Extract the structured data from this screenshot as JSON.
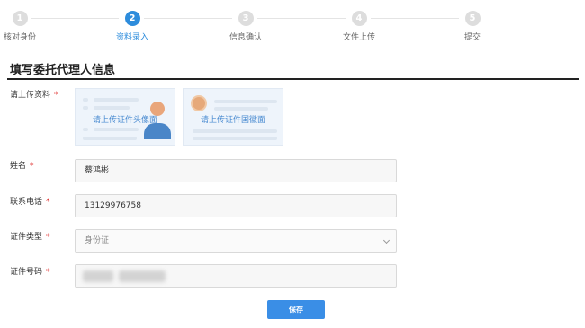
{
  "steps": [
    {
      "number": "1",
      "label": "核对身份",
      "active": false
    },
    {
      "number": "2",
      "label": "资料录入",
      "active": true
    },
    {
      "number": "3",
      "label": "信息确认",
      "active": false
    },
    {
      "number": "4",
      "label": "文件上传",
      "active": false
    },
    {
      "number": "5",
      "label": "提交",
      "active": false
    }
  ],
  "section_title": "填写委托代理人信息",
  "form": {
    "upload": {
      "label": "请上传资料",
      "front_card_text": "请上传证件头像面",
      "back_card_text": "请上传证件国徽面"
    },
    "name": {
      "label": "姓名",
      "value": "蔡鸿彬"
    },
    "phone": {
      "label": "联系电话",
      "value": "13129976758"
    },
    "id_type": {
      "label": "证件类型",
      "value": "身份证"
    },
    "id_number": {
      "label": "证件号码",
      "value": ""
    }
  },
  "required_mark": "*",
  "save_label": "保存",
  "colors": {
    "accent": "#2d8cdc",
    "required": "#e0302f",
    "button": "#3a8ee6"
  }
}
